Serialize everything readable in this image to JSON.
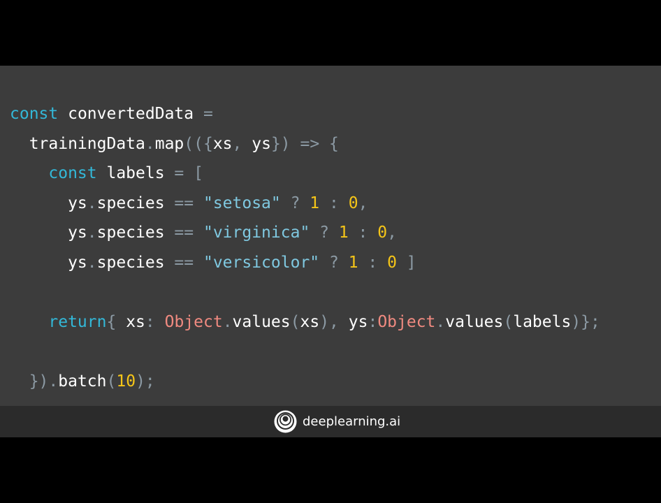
{
  "code": {
    "lines": [
      [
        {
          "t": "const",
          "c": "kw"
        },
        {
          "t": " convertedData ",
          "c": "id"
        },
        {
          "t": "=",
          "c": "pn"
        }
      ],
      [
        {
          "t": "  trainingData",
          "c": "id"
        },
        {
          "t": ".",
          "c": "pn"
        },
        {
          "t": "map",
          "c": "id"
        },
        {
          "t": "(({",
          "c": "pn"
        },
        {
          "t": "xs",
          "c": "id"
        },
        {
          "t": ", ",
          "c": "pn"
        },
        {
          "t": "ys",
          "c": "id"
        },
        {
          "t": "}) => {",
          "c": "pn"
        }
      ],
      [
        {
          "t": "    ",
          "c": "id"
        },
        {
          "t": "const",
          "c": "kw"
        },
        {
          "t": " labels ",
          "c": "id"
        },
        {
          "t": "= [",
          "c": "pn"
        }
      ],
      [
        {
          "t": "      ys",
          "c": "id"
        },
        {
          "t": ".",
          "c": "pn"
        },
        {
          "t": "species ",
          "c": "id"
        },
        {
          "t": "== ",
          "c": "pn"
        },
        {
          "t": "\"setosa\"",
          "c": "str"
        },
        {
          "t": " ? ",
          "c": "pn"
        },
        {
          "t": "1",
          "c": "num"
        },
        {
          "t": " : ",
          "c": "pn"
        },
        {
          "t": "0",
          "c": "num"
        },
        {
          "t": ",",
          "c": "pn"
        }
      ],
      [
        {
          "t": "      ys",
          "c": "id"
        },
        {
          "t": ".",
          "c": "pn"
        },
        {
          "t": "species ",
          "c": "id"
        },
        {
          "t": "== ",
          "c": "pn"
        },
        {
          "t": "\"virginica\"",
          "c": "str"
        },
        {
          "t": " ? ",
          "c": "pn"
        },
        {
          "t": "1",
          "c": "num"
        },
        {
          "t": " : ",
          "c": "pn"
        },
        {
          "t": "0",
          "c": "num"
        },
        {
          "t": ",",
          "c": "pn"
        }
      ],
      [
        {
          "t": "      ys",
          "c": "id"
        },
        {
          "t": ".",
          "c": "pn"
        },
        {
          "t": "species ",
          "c": "id"
        },
        {
          "t": "== ",
          "c": "pn"
        },
        {
          "t": "\"versicolor\"",
          "c": "str"
        },
        {
          "t": " ? ",
          "c": "pn"
        },
        {
          "t": "1",
          "c": "num"
        },
        {
          "t": " : ",
          "c": "pn"
        },
        {
          "t": "0",
          "c": "num"
        },
        {
          "t": " ]",
          "c": "pn"
        }
      ],
      [],
      [
        {
          "t": "    ",
          "c": "id"
        },
        {
          "t": "return",
          "c": "kw"
        },
        {
          "t": "{ ",
          "c": "pn"
        },
        {
          "t": "xs",
          "c": "id"
        },
        {
          "t": ": ",
          "c": "pn"
        },
        {
          "t": "Object",
          "c": "obj"
        },
        {
          "t": ".",
          "c": "pn"
        },
        {
          "t": "values",
          "c": "id"
        },
        {
          "t": "(",
          "c": "pn"
        },
        {
          "t": "xs",
          "c": "id"
        },
        {
          "t": "), ",
          "c": "pn"
        },
        {
          "t": "ys",
          "c": "id"
        },
        {
          "t": ":",
          "c": "pn"
        },
        {
          "t": "Object",
          "c": "obj"
        },
        {
          "t": ".",
          "c": "pn"
        },
        {
          "t": "values",
          "c": "id"
        },
        {
          "t": "(",
          "c": "pn"
        },
        {
          "t": "labels",
          "c": "id"
        },
        {
          "t": ")};",
          "c": "pn"
        }
      ],
      [],
      [
        {
          "t": "  })",
          "c": "pn"
        },
        {
          "t": ".",
          "c": "pn"
        },
        {
          "t": "batch",
          "c": "id"
        },
        {
          "t": "(",
          "c": "pn"
        },
        {
          "t": "10",
          "c": "num"
        },
        {
          "t": ");",
          "c": "pn"
        }
      ]
    ]
  },
  "footer": {
    "brand_name": "deeplearning.ai",
    "logo_icon": "deeplearning-logo-icon"
  },
  "colors": {
    "keyword": "#33b8d8",
    "identifier": "#ffffff",
    "punctuation": "#8c9aa4",
    "string": "#7fc8e0",
    "number": "#f5c518",
    "object": "#f08a80",
    "slide_background": "#3c3c3c",
    "footer_background": "#2b2b2b"
  }
}
